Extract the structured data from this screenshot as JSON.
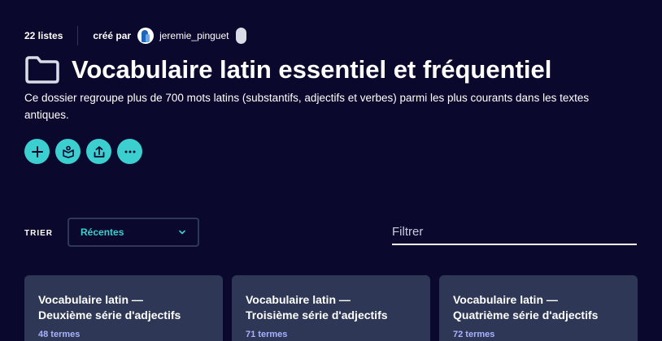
{
  "meta": {
    "list_count": "22 listes",
    "creator_label": "créé par",
    "creator_name": "jeremie_pinguet"
  },
  "folder": {
    "title": "Vocabulaire latin essentiel et fréquentiel",
    "description": "Ce dossier regroupe plus de 700 mots latins (substantifs, adjectifs et verbes) parmi les plus courants dans les textes antiques."
  },
  "actions": [
    {
      "icon": "plus-icon"
    },
    {
      "icon": "study-icon"
    },
    {
      "icon": "share-icon"
    },
    {
      "icon": "more-icon"
    }
  ],
  "sort": {
    "label": "TRIER",
    "selected": "Récentes"
  },
  "filter": {
    "placeholder": "Filtrer"
  },
  "cards": [
    {
      "title": "Vocabulaire latin —\nDeuxième série d'adjectifs",
      "count": "48 termes"
    },
    {
      "title": "Vocabulaire latin —\nTroisième série d'adjectifs",
      "count": "71 termes"
    },
    {
      "title": "Vocabulaire latin —\nQuatrième série d'adjectifs",
      "count": "72 termes"
    }
  ],
  "colors": {
    "background": "#0a092d",
    "accent": "#3ccfcf",
    "card": "#2e3856",
    "muted": "#a8b1ff"
  }
}
